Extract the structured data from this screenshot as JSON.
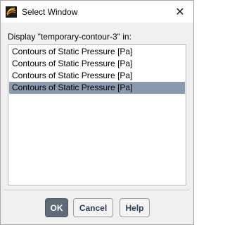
{
  "window": {
    "title": "Select Window",
    "close_glyph": "✕"
  },
  "prompt": "Display \"temporary-contour-3\" in:",
  "list": {
    "items": [
      {
        "label": "Contours of Static Pressure [Pa]",
        "selected": false
      },
      {
        "label": "Contours of Static Pressure [Pa]",
        "selected": false
      },
      {
        "label": "Contours of Static Pressure [Pa]",
        "selected": false
      },
      {
        "label": "Contours of Static Pressure [Pa]",
        "selected": true
      }
    ],
    "selected_color": "#8a99ad"
  },
  "buttons": {
    "ok": "OK",
    "cancel": "Cancel",
    "help": "Help"
  },
  "icons": {
    "app": "fluent-app-icon",
    "close": "close-icon"
  }
}
